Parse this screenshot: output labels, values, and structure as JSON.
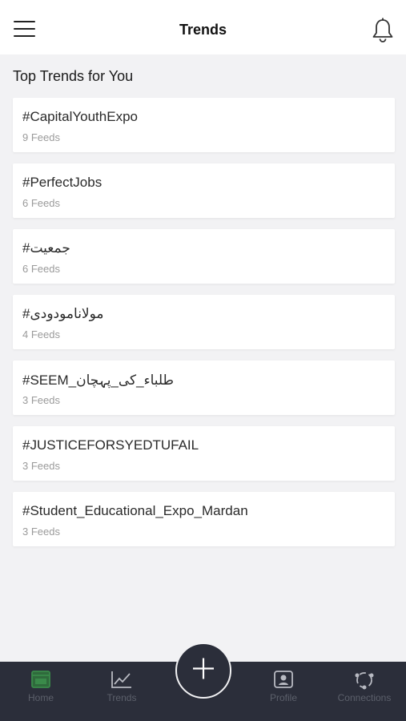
{
  "header": {
    "title": "Trends",
    "menu_icon": "hamburger-menu-icon",
    "notification_icon": "bell-icon"
  },
  "section": {
    "title": "Top Trends for You"
  },
  "trends": [
    {
      "tag": "#CapitalYouthExpo",
      "count": "9 Feeds"
    },
    {
      "tag": "#PerfectJobs",
      "count": "6 Feeds"
    },
    {
      "tag": "#جمعیت",
      "count": "6 Feeds"
    },
    {
      "tag": "#مولانامودودی",
      "count": "4 Feeds"
    },
    {
      "tag": "#SEEM_طلباء_کی_پہچان",
      "count": "3 Feeds"
    },
    {
      "tag": "#JUSTICEFORSYEDTUFAIL",
      "count": "3 Feeds"
    },
    {
      "tag": "#Student_Educational_Expo_Mardan",
      "count": "3 Feeds"
    }
  ],
  "bottom_nav": {
    "items": [
      {
        "label": "Home",
        "icon": "home-icon"
      },
      {
        "label": "Trends",
        "icon": "trending-chart-icon"
      },
      {
        "label": "Profile",
        "icon": "profile-icon"
      },
      {
        "label": "Connections",
        "icon": "connections-icon"
      }
    ],
    "fab_icon": "plus-icon"
  },
  "colors": {
    "background": "#f2f2f4",
    "nav_background": "#2b2e3a",
    "home_active": "#3a8a4a",
    "nav_inactive": "#5c606b"
  }
}
